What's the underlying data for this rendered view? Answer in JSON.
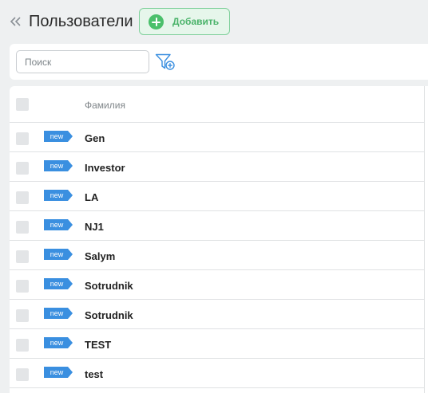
{
  "header": {
    "title": "Пользователи",
    "add_label": "Добавить",
    "collapse_icon": "double-chevron-left-icon",
    "add_icon": "plus-circle-icon"
  },
  "filter": {
    "search_placeholder": "Поиск",
    "search_value": "",
    "filter_icon": "filter-add-icon"
  },
  "table": {
    "column_header": "Фамилия",
    "badge_label": "new",
    "rows": [
      {
        "badge": "new",
        "name": "Gen"
      },
      {
        "badge": "new",
        "name": "Investor"
      },
      {
        "badge": "new",
        "name": "LA"
      },
      {
        "badge": "new",
        "name": "NJ1"
      },
      {
        "badge": "new",
        "name": "Salym"
      },
      {
        "badge": "new",
        "name": "Sotrudnik"
      },
      {
        "badge": "new",
        "name": "Sotrudnik"
      },
      {
        "badge": "new",
        "name": "TEST"
      },
      {
        "badge": "new",
        "name": "test"
      }
    ]
  },
  "colors": {
    "accent_green": "#4ac06b",
    "badge_blue": "#3a8fe0",
    "filter_blue": "#3a8fe0"
  }
}
